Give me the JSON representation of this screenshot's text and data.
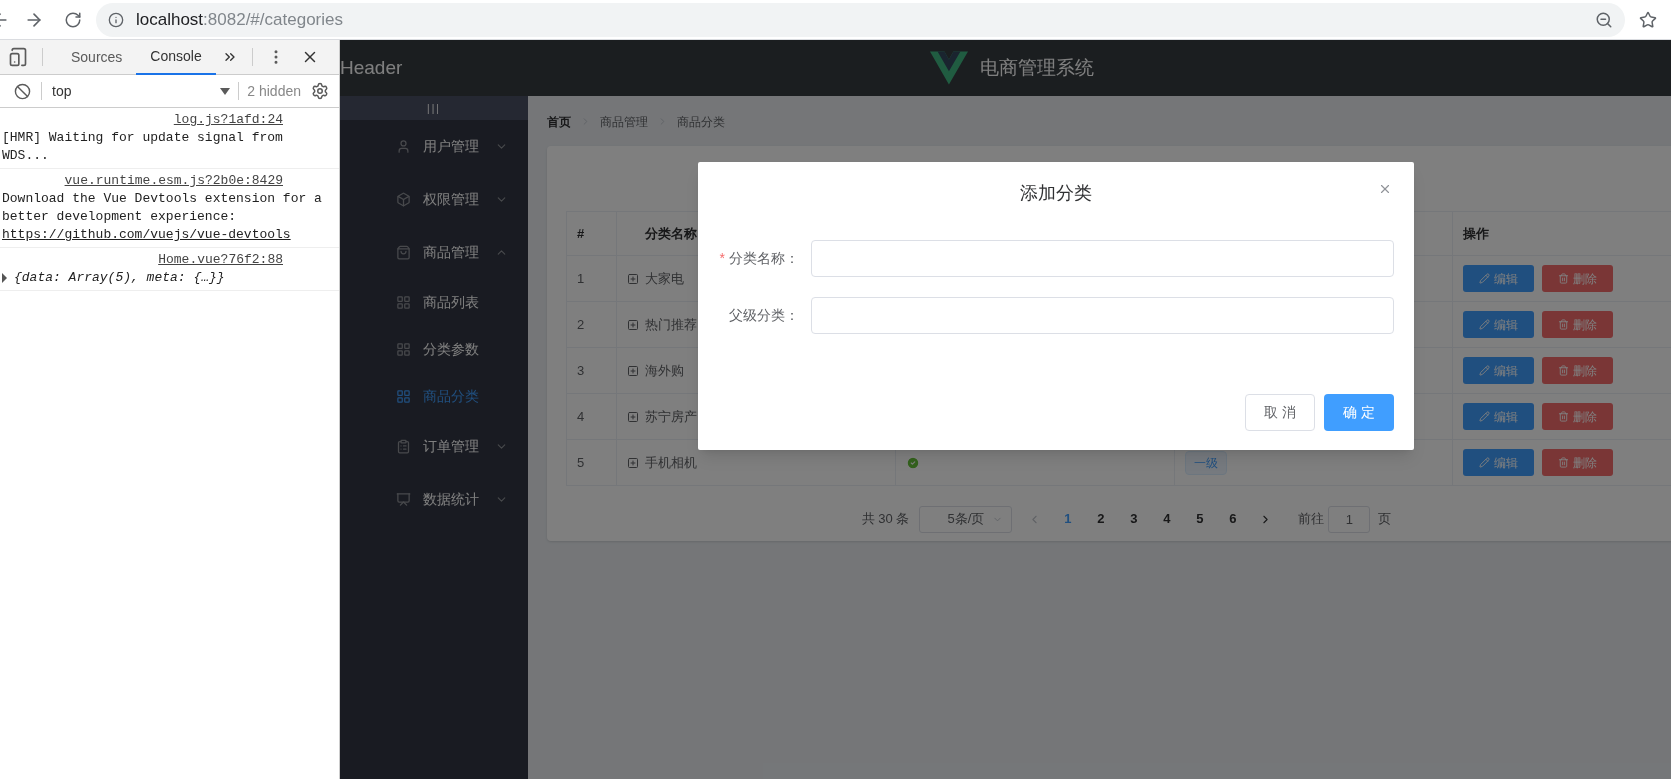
{
  "browser": {
    "url_host": "localhost",
    "url_path": ":8082/#/categories"
  },
  "devtools": {
    "tabs": [
      {
        "label": "Sources",
        "selected": false
      },
      {
        "label": "Console",
        "selected": true
      }
    ],
    "context": "top",
    "hidden": "2 hidden",
    "messages": [
      {
        "text": "[HMR] Waiting for update signal from WDS...",
        "source": "log.js?1afd:24"
      },
      {
        "text": "Download the Vue Devtools extension for a better development experience:",
        "link": "https://github.com/vuejs/vue-devtools",
        "source": "vue.runtime.esm.js?2b0e:8429"
      },
      {
        "source": "Home.vue?76f2:88",
        "object": "{data: Array(5), meta: {…}}",
        "expanded": false
      }
    ]
  },
  "header": {
    "label": "Header",
    "title": "电商管理系统"
  },
  "sidebar": {
    "toggle": "|||",
    "menus": [
      {
        "label": "用户管理",
        "expanded": false
      },
      {
        "label": "权限管理",
        "expanded": false
      },
      {
        "label": "商品管理",
        "expanded": true,
        "children": [
          {
            "label": "商品列表",
            "selected": false
          },
          {
            "label": "分类参数",
            "selected": false
          },
          {
            "label": "商品分类",
            "selected": true
          }
        ]
      },
      {
        "label": "订单管理",
        "expanded": false
      },
      {
        "label": "数据统计",
        "expanded": false
      }
    ]
  },
  "breadcrumb": [
    "首页",
    "商品管理",
    "商品分类"
  ],
  "table": {
    "columns": {
      "index": "#",
      "name": "分类名称",
      "actions": "操作"
    },
    "rows": [
      {
        "index": "1",
        "name": "大家电",
        "actions": [
          "编辑",
          "删除"
        ]
      },
      {
        "index": "2",
        "name": "热门推荐",
        "actions": [
          "编辑",
          "删除"
        ]
      },
      {
        "index": "3",
        "name": "海外购",
        "actions": [
          "编辑",
          "删除"
        ]
      },
      {
        "index": "4",
        "name": "苏宁房产",
        "actions": [
          "编辑",
          "删除"
        ]
      },
      {
        "index": "5",
        "name": "手机相机",
        "valid": true,
        "tier": "一级",
        "actions": [
          "编辑",
          "删除"
        ]
      }
    ]
  },
  "pagination": {
    "total": "共 30 条",
    "page_size": "5条/页",
    "pages": [
      {
        "label": "1",
        "selected": true
      },
      {
        "label": "2",
        "selected": false
      },
      {
        "label": "3",
        "selected": false
      },
      {
        "label": "4",
        "selected": false
      },
      {
        "label": "5",
        "selected": false
      },
      {
        "label": "6",
        "selected": false
      }
    ],
    "goto_label": "前往",
    "goto_value": "1",
    "goto_suffix": "页"
  },
  "dialog": {
    "title": "添加分类",
    "required_symbol": "*",
    "fields": [
      {
        "label": "分类名称：",
        "required": true
      },
      {
        "label": "父级分类：",
        "required": false
      }
    ],
    "buttons": [
      {
        "label": "取 消",
        "kind": "default"
      },
      {
        "label": "确 定",
        "kind": "primary"
      }
    ]
  }
}
